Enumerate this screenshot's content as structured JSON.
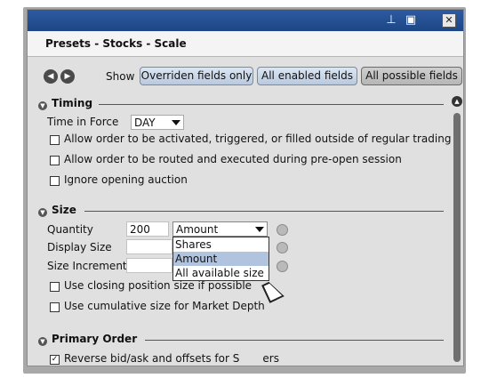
{
  "header": {
    "breadcrumb": "Presets - Stocks - Scale"
  },
  "titlebar": {
    "pin_icon": "pin-icon",
    "print_icon": "print-icon",
    "close_glyph": "✕"
  },
  "showbar": {
    "label": "Show",
    "buttons": [
      "Overriden fields only",
      "All enabled fields",
      "All possible fields"
    ],
    "active_index": 2
  },
  "timing": {
    "title": "Timing",
    "time_in_force_label": "Time in Force",
    "time_in_force_value": "DAY",
    "options": [
      {
        "label": "Allow order to be activated, triggered, or filled outside of regular trading hours",
        "checked": false
      },
      {
        "label": "Allow order to be routed and executed during pre-open session",
        "checked": false
      },
      {
        "label": "Ignore opening auction",
        "checked": false
      }
    ]
  },
  "size": {
    "title": "Size",
    "quantity_label": "Quantity",
    "quantity_value": "200",
    "quantity_unit": "Amount",
    "display_size_label": "Display Size",
    "size_increment_label": "Size Increment",
    "dropdown_options": [
      "Shares",
      "Amount",
      "All available size"
    ],
    "dropdown_selected_index": 1,
    "options": [
      {
        "label": "Use closing position size if possible",
        "checked": false
      },
      {
        "label": "Use cumulative size for Market Depth",
        "checked": false
      }
    ]
  },
  "primary_order": {
    "title": "Primary Order",
    "option_label": "Reverse bid/ask and offsets for S",
    "option_label_tail": "ers",
    "checked": true
  },
  "colors": {
    "titlebar": "#1d4686",
    "accent_button": "#b9c9de",
    "selected_item": "#b0c4e0"
  }
}
